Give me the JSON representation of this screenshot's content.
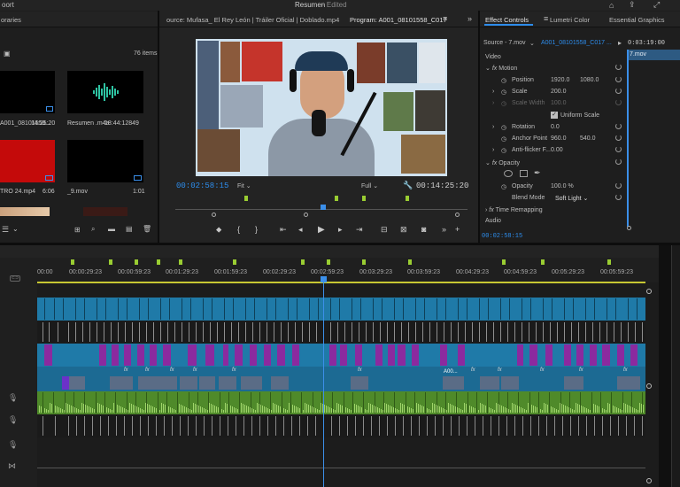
{
  "titlebar": {
    "left": "oort",
    "center": "Resumen",
    "edited": "- Edited"
  },
  "project": {
    "tab_label": "oraries",
    "count": "76 items",
    "items": [
      {
        "name": "A001_08101558...",
        "duration": "14:25:20"
      },
      {
        "name": "Resumen .m4a",
        "duration": "18:44:12849"
      },
      {
        "name": "TRO 24.mp4",
        "duration": "6:06"
      },
      {
        "name": "_9.mov",
        "duration": "1:01"
      }
    ]
  },
  "source": {
    "tab_label": "ource: Mufasa_ El Rey León | Tráiler Oficial | Doblado.mp4"
  },
  "program": {
    "tab_label": "Program: A001_08101558_C017",
    "timecode": "00:02:58:15",
    "fit": "Fit",
    "quality": "Full",
    "duration": "00:14:25:20"
  },
  "effect_controls": {
    "tabs": [
      "Effect Controls",
      "Lumetri Color",
      "Essential Graphics"
    ],
    "source": "Source - 7.mov",
    "clip": "A001_08101558_C017 ...",
    "mini_timecode": "0:03:19:00",
    "mini_clip": "7.mov",
    "section_video": "Video",
    "motion": "Motion",
    "position_label": "Position",
    "position_x": "1920.0",
    "position_y": "1080.0",
    "scale_label": "Scale",
    "scale_value": "200.0",
    "scale_width_label": "Scale Width",
    "scale_width_value": "100.0",
    "uniform_scale": "Uniform Scale",
    "rotation_label": "Rotation",
    "rotation_value": "0.0",
    "anchor_label": "Anchor Point",
    "anchor_x": "960.0",
    "anchor_y": "540.0",
    "antiflicker_label": "Anti-flicker F...",
    "antiflicker_value": "0.00",
    "opacity": "Opacity",
    "opacity_label": "Opacity",
    "opacity_value": "100.0 %",
    "blend_label": "Blend Mode",
    "blend_value": "Soft Light",
    "time_remap": "Time Remapping",
    "section_audio": "Audio",
    "bottom_timecode": "00:02:58:15"
  },
  "timeline": {
    "ruler": [
      "00:00",
      "00:00:29:23",
      "00:00:59:23",
      "00:01:29:23",
      "00:01:59:23",
      "00:02:29:23",
      "00:02:59:23",
      "00:03:29:23",
      "00:03:59:23",
      "00:04:29:23",
      "00:04:59:23",
      "00:05:29:23",
      "00:05:59:23"
    ],
    "clip_label": "A00...",
    "fx": "fx"
  },
  "colors": {
    "accent": "#2d8ceb",
    "video_track": "#1f7aa8",
    "magenta_track": "#8b2a9f",
    "audio_track": "#5a9a2e",
    "playhead": "#3b8fe9"
  }
}
